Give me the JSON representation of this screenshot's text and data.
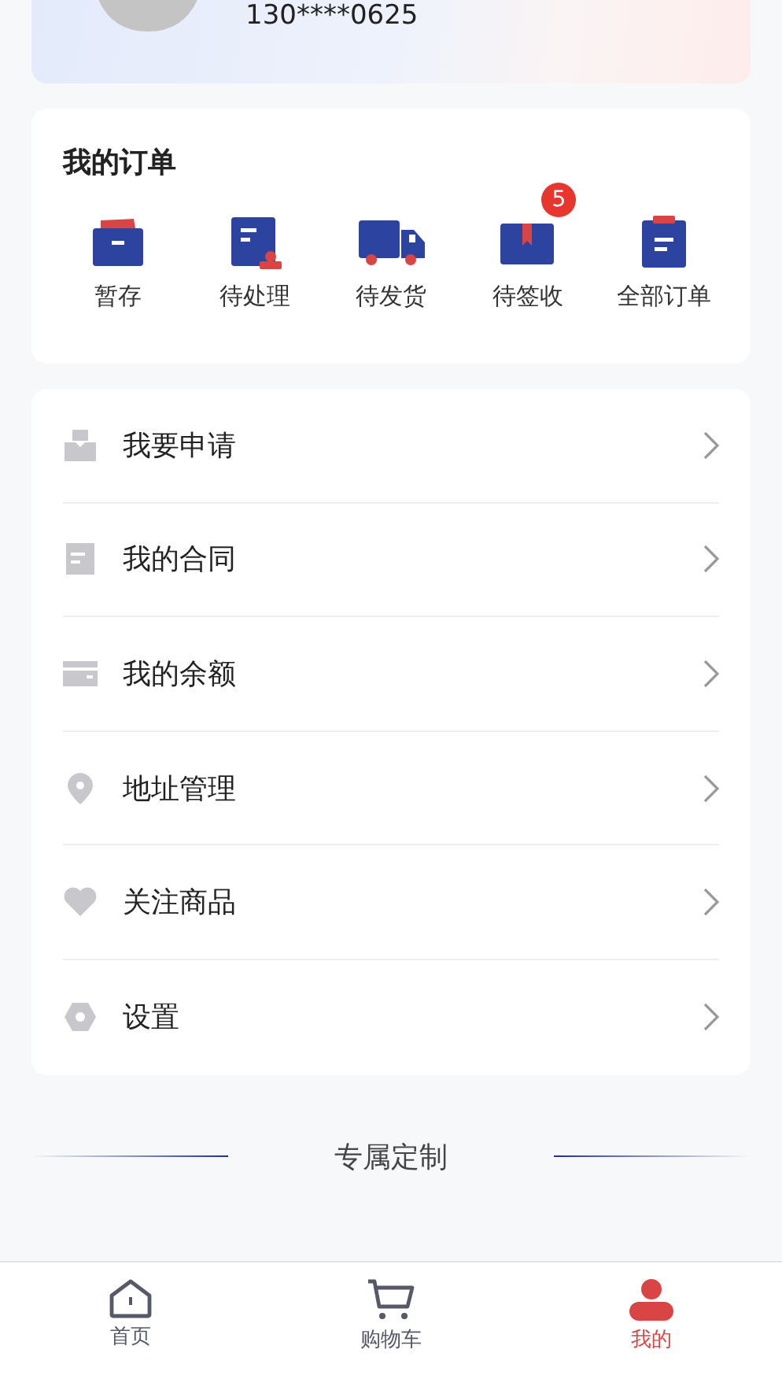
{
  "profile": {
    "phone": "130****0625"
  },
  "orders": {
    "title": "我的订单",
    "items": [
      {
        "label": "暂存",
        "kind": "folder"
      },
      {
        "label": "待处理",
        "kind": "document"
      },
      {
        "label": "待发货",
        "kind": "truck"
      },
      {
        "label": "待签收",
        "kind": "box",
        "badge": "5"
      },
      {
        "label": "全部订单",
        "kind": "clipboard"
      }
    ]
  },
  "menu": [
    {
      "label": "我要申请",
      "kind": "tray"
    },
    {
      "label": "我的合同",
      "kind": "document"
    },
    {
      "label": "我的余额",
      "kind": "card"
    },
    {
      "label": "地址管理",
      "kind": "pin"
    },
    {
      "label": "关注商品",
      "kind": "heart"
    },
    {
      "label": "设置",
      "kind": "hexagon"
    }
  ],
  "section_title": "专属定制",
  "tab_bar": [
    {
      "label": "首页",
      "kind": "home",
      "selected": false
    },
    {
      "label": "购物车",
      "kind": "cart",
      "selected": false
    },
    {
      "label": "我的",
      "kind": "person",
      "selected": true
    }
  ]
}
